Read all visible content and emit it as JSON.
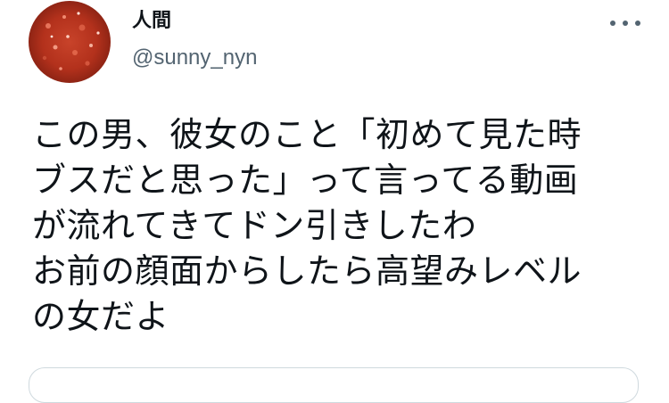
{
  "tweet": {
    "display_name": "人間",
    "handle": "@sunny_nyn",
    "text_lines": [
      "この男、彼女のこと「初めて見た時",
      "ブスだと思った」って言ってる動画",
      "が流れてきてドン引きしたわ",
      "お前の顔面からしたら高望みレベル",
      "の女だよ"
    ]
  },
  "icons": {
    "more": "more-horizontal-icon"
  },
  "colors": {
    "text_primary": "#0f1419",
    "text_secondary": "#536471",
    "border": "#cfd9de",
    "avatar_primary": "#b3311c"
  }
}
